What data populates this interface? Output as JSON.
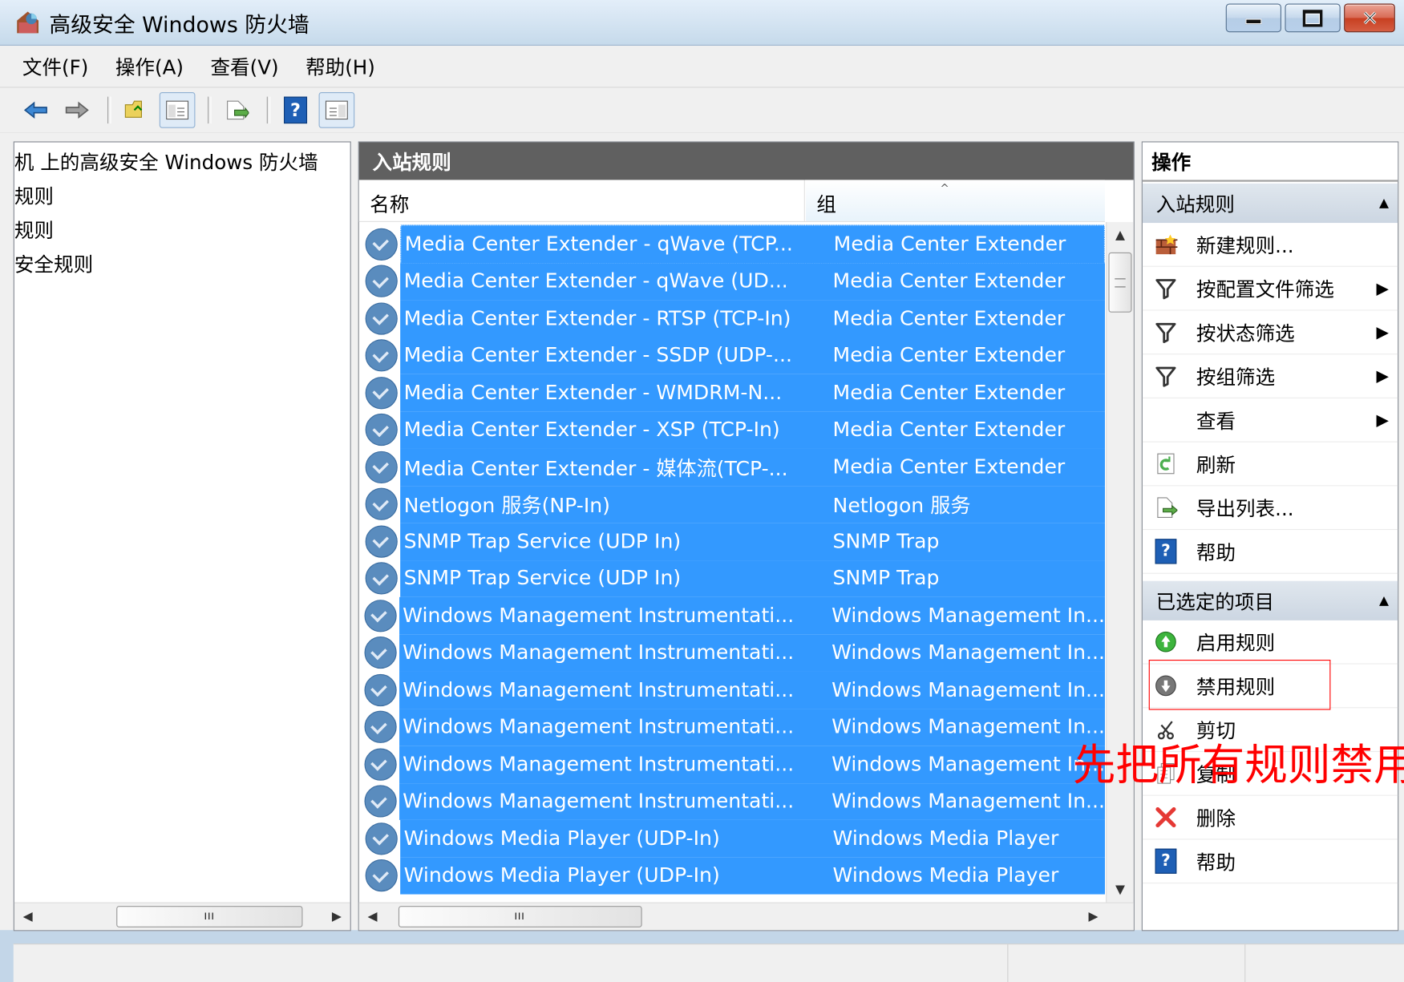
{
  "window": {
    "title": "高级安全 Windows 防火墙"
  },
  "menu": [
    "文件(F)",
    "操作(A)",
    "查看(V)",
    "帮助(H)"
  ],
  "toolbar": {
    "buttons": [
      "back-icon",
      "forward-icon",
      "up-folder-icon",
      "show-hide-console-tree-icon",
      "export-list-icon",
      "help-icon",
      "show-hide-action-pane-icon"
    ]
  },
  "left_tree": [
    "机 上的高级安全 Windows 防火墙",
    "规则",
    "规则",
    "安全规则"
  ],
  "main_panel": {
    "title": "入站规则",
    "columns": [
      "名称",
      "组"
    ],
    "rows": [
      {
        "name": "Media Center Extender - qWave (TCP...",
        "group": "Media Center Extender"
      },
      {
        "name": "Media Center Extender - qWave (UD...",
        "group": "Media Center Extender"
      },
      {
        "name": "Media Center Extender - RTSP (TCP-In)",
        "group": "Media Center Extender"
      },
      {
        "name": "Media Center Extender - SSDP (UDP-...",
        "group": "Media Center Extender"
      },
      {
        "name": "Media Center Extender - WMDRM-N...",
        "group": "Media Center Extender"
      },
      {
        "name": "Media Center Extender - XSP (TCP-In)",
        "group": "Media Center Extender"
      },
      {
        "name": "Media Center Extender - 媒体流(TCP-...",
        "group": "Media Center Extender"
      },
      {
        "name": "Netlogon 服务(NP-In)",
        "group": "Netlogon 服务"
      },
      {
        "name": "SNMP Trap Service (UDP In)",
        "group": "SNMP Trap"
      },
      {
        "name": "SNMP Trap Service (UDP In)",
        "group": "SNMP Trap"
      },
      {
        "name": "Windows Management Instrumentati...",
        "group": "Windows Management In..."
      },
      {
        "name": "Windows Management Instrumentati...",
        "group": "Windows Management In..."
      },
      {
        "name": "Windows Management Instrumentati...",
        "group": "Windows Management In..."
      },
      {
        "name": "Windows Management Instrumentati...",
        "group": "Windows Management In..."
      },
      {
        "name": "Windows Management Instrumentati...",
        "group": "Windows Management In..."
      },
      {
        "name": "Windows Management Instrumentati...",
        "group": "Windows Management In..."
      },
      {
        "name": "Windows Media Player (UDP-In)",
        "group": "Windows Media Player"
      },
      {
        "name": "Windows Media Player (UDP-In)",
        "group": "Windows Media Player"
      }
    ]
  },
  "actions_panel": {
    "title": "操作",
    "sections": [
      {
        "header": "入站规则",
        "items": [
          {
            "label": "新建规则...",
            "icon": "new-rule-icon"
          },
          {
            "label": "按配置文件筛选",
            "icon": "filter-icon",
            "arrow": true
          },
          {
            "label": "按状态筛选",
            "icon": "filter-icon",
            "arrow": true
          },
          {
            "label": "按组筛选",
            "icon": "filter-icon",
            "arrow": true
          },
          {
            "label": "查看",
            "icon": "",
            "arrow": true
          },
          {
            "label": "刷新",
            "icon": "refresh-icon"
          },
          {
            "label": "导出列表...",
            "icon": "export-list-icon"
          },
          {
            "label": "帮助",
            "icon": "help-icon"
          }
        ]
      },
      {
        "header": "已选定的项目",
        "items": [
          {
            "label": "启用规则",
            "icon": "enable-rule-icon"
          },
          {
            "label": "禁用规则",
            "icon": "disable-rule-icon"
          },
          {
            "label": "剪切",
            "icon": "cut-icon"
          },
          {
            "label": "复制",
            "icon": "copy-icon"
          },
          {
            "label": "删除",
            "icon": "delete-icon"
          },
          {
            "label": "帮助",
            "icon": "help-icon"
          }
        ]
      }
    ]
  },
  "annotation": "先把所有规则禁用"
}
